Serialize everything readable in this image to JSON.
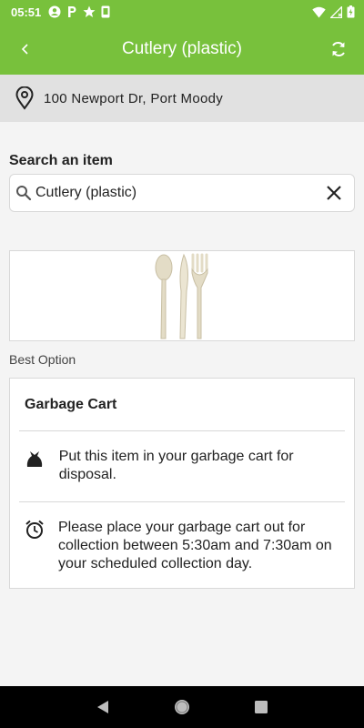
{
  "status_bar": {
    "time": "05:51"
  },
  "app_bar": {
    "title": "Cutlery (plastic)"
  },
  "address": {
    "text": "100 Newport Dr, Port Moody"
  },
  "search": {
    "label": "Search an item",
    "value": "Cutlery (plastic)"
  },
  "best_option_label": "Best Option",
  "option": {
    "title": "Garbage Cart",
    "rows": [
      {
        "icon": "garbage-bag-icon",
        "text": "Put this item in your garbage cart for disposal."
      },
      {
        "icon": "alarm-clock-icon",
        "text": "Please place your garbage cart out for collection between 5:30am and 7:30am on your scheduled collection day."
      }
    ]
  },
  "colors": {
    "accent": "#78c13c",
    "address_bg": "#e1e1e1",
    "background": "#f4f4f4"
  }
}
